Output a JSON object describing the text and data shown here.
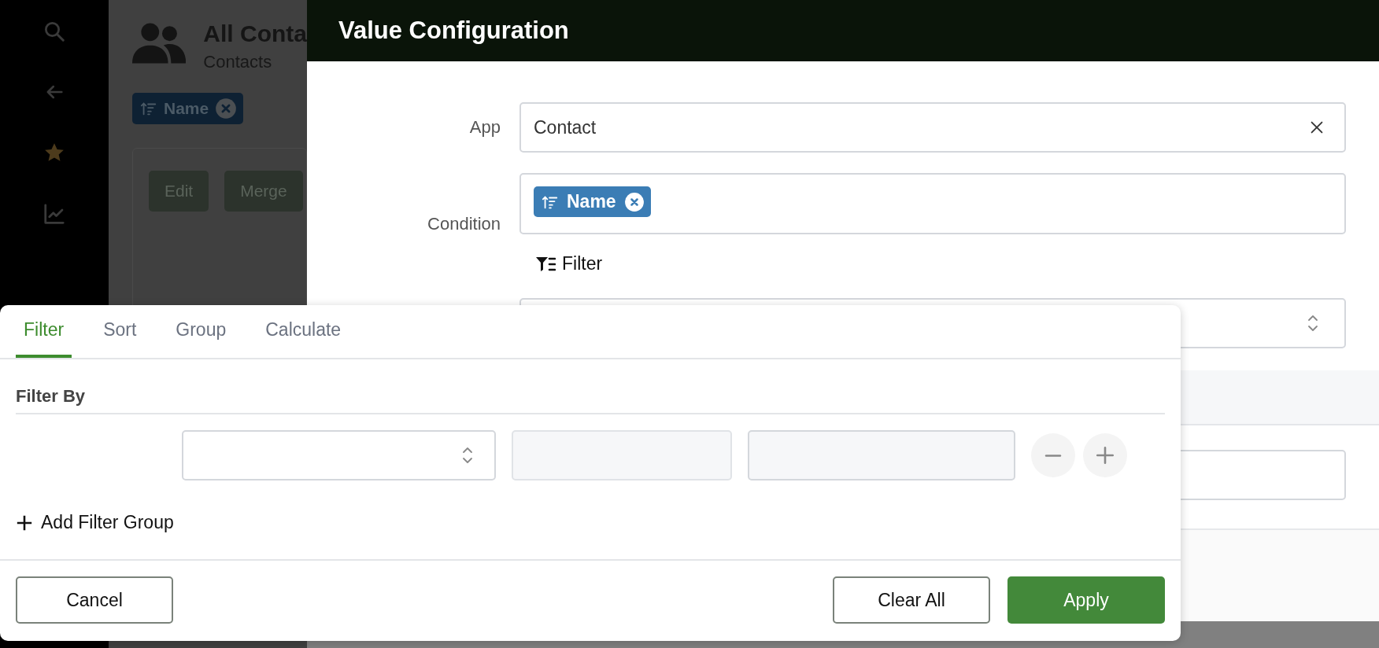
{
  "background": {
    "title": "All Conta",
    "subtitle": "Contacts",
    "sort_chip": "Name",
    "buttons": [
      "Edit",
      "Merge"
    ]
  },
  "dialog": {
    "title": "Value Configuration",
    "app": {
      "label": "App",
      "value": "Contact"
    },
    "condition": {
      "label": "Condition",
      "chip": "Name"
    },
    "filter_link": "Filter"
  },
  "popover": {
    "tabs": [
      {
        "label": "Filter",
        "selected": true
      },
      {
        "label": "Sort",
        "selected": false
      },
      {
        "label": "Group",
        "selected": false
      },
      {
        "label": "Calculate",
        "selected": false
      }
    ],
    "section": "Filter By",
    "add_group": "Add Filter Group",
    "buttons": [
      {
        "label": "Cancel",
        "kind": "secondary"
      },
      {
        "label": "Clear All",
        "kind": "secondary"
      },
      {
        "label": "Apply",
        "kind": "primary"
      }
    ]
  }
}
